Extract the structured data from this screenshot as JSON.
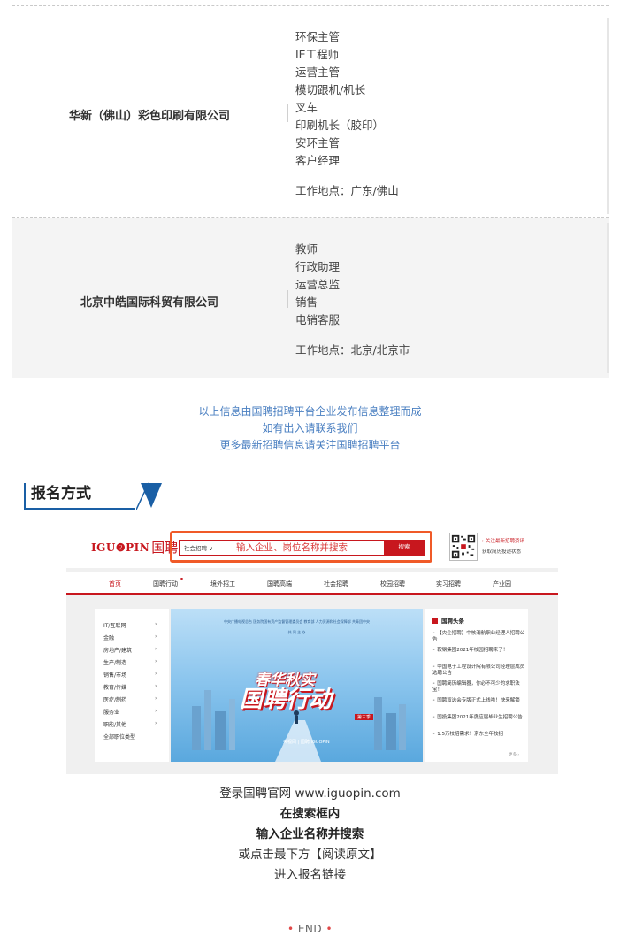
{
  "companies": [
    {
      "name": "华新（佛山）彩色印刷有限公司",
      "positions": [
        "环保主管",
        "IE工程师",
        "运营主管",
        "模切跟机/机长",
        "叉车",
        "印刷机长（胶印）",
        "安环主管",
        "客户经理"
      ],
      "location": "工作地点：广东/佛山"
    },
    {
      "name": "北京中皓国际科贸有限公司",
      "positions": [
        "教师",
        "行政助理",
        "运营总监",
        "销售",
        "电销客服"
      ],
      "location": "工作地点：北京/北京市"
    }
  ],
  "notice": {
    "line1": "以上信息由国聘招聘平台企业发布信息整理而成",
    "line2": "如有出入请联系我们",
    "line3": "更多最新招聘信息请关注国聘招聘平台"
  },
  "section": {
    "title": "报名方式"
  },
  "site": {
    "logo_text": "IGU❷PIN",
    "logo_cn": "国聘",
    "search_type": "社会招聘 ∨",
    "search_placeholder": "输入企业、岗位名称并搜索",
    "search_button": "搜索",
    "qr_line1": "› 关注最新招聘资讯",
    "qr_line2": "获取简历投递状态",
    "nav": [
      "首页",
      "国聘行动",
      "境外招工",
      "国聘高端",
      "社会招聘",
      "校园招聘",
      "实习招聘",
      "产业园"
    ],
    "categories": [
      "IT/互联网",
      "金融",
      "房地产/建筑",
      "生产/制造",
      "销售/市场",
      "教育/传媒",
      "医疗/制药",
      "服务业",
      "职能/其他",
      "全部职位类型"
    ],
    "banner": {
      "top_line": "中央广播电视总台   国务院国有资产监督管理委员会   教育部   人力资源和社会保障部   共青团中央",
      "sub_line": "共 同 主 办",
      "headline": "春华秋实",
      "title": "国聘行动",
      "badge": "第三季",
      "logo": "央视网  |  国聘 IGUOPIN"
    },
    "headlines_title": "国聘头条",
    "news": [
      "【央企招聘】中核浦航职业经理人招聘公告",
      "鞍钢集团2021年校园招聘来了！",
      "中国电子工程设计院有限公司经理层成员选聘公告",
      "国聘简历编辑器，你必不可少的求职法宝！",
      "国聘双选会专版正式上线啦！快来解锁",
      "国投集团2021年度应届毕业生招聘公告",
      "1.5万校招需求！京东全年校招"
    ],
    "more": "更多 ›"
  },
  "instructions": {
    "line1": "登录国聘官网 www.iguopin.com",
    "line2": "在搜索框内",
    "line3": "输入企业名称并搜索",
    "line4": "或点击最下方【阅读原文】",
    "line5": "进入报名链接"
  },
  "end": {
    "text": "END"
  },
  "colors": {
    "accent_red": "#c8171e",
    "link_blue": "#4a7fc1",
    "heading_blue": "#1a5fa5",
    "highlight_orange": "#f05a28"
  }
}
